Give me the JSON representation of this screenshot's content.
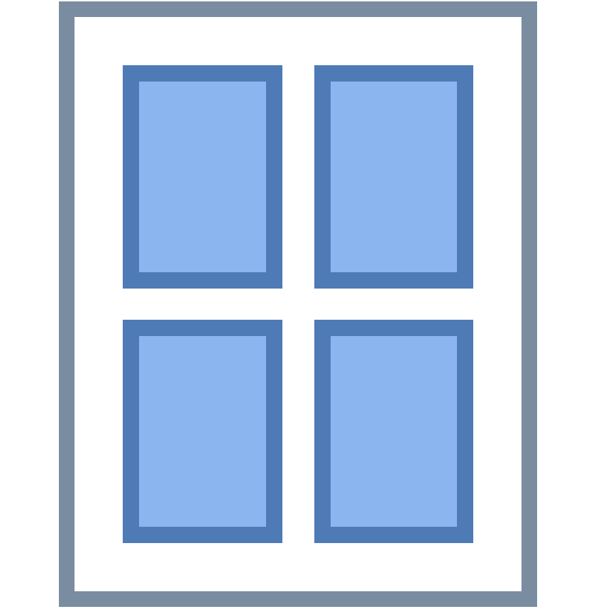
{
  "icon": {
    "name": "window-icon",
    "frame_color": "#7a8ca0",
    "sash_color": "#ffffff",
    "pane_border_color": "#4e7ab5",
    "pane_fill_color": "#8ab5ef",
    "pane_count": 4
  }
}
